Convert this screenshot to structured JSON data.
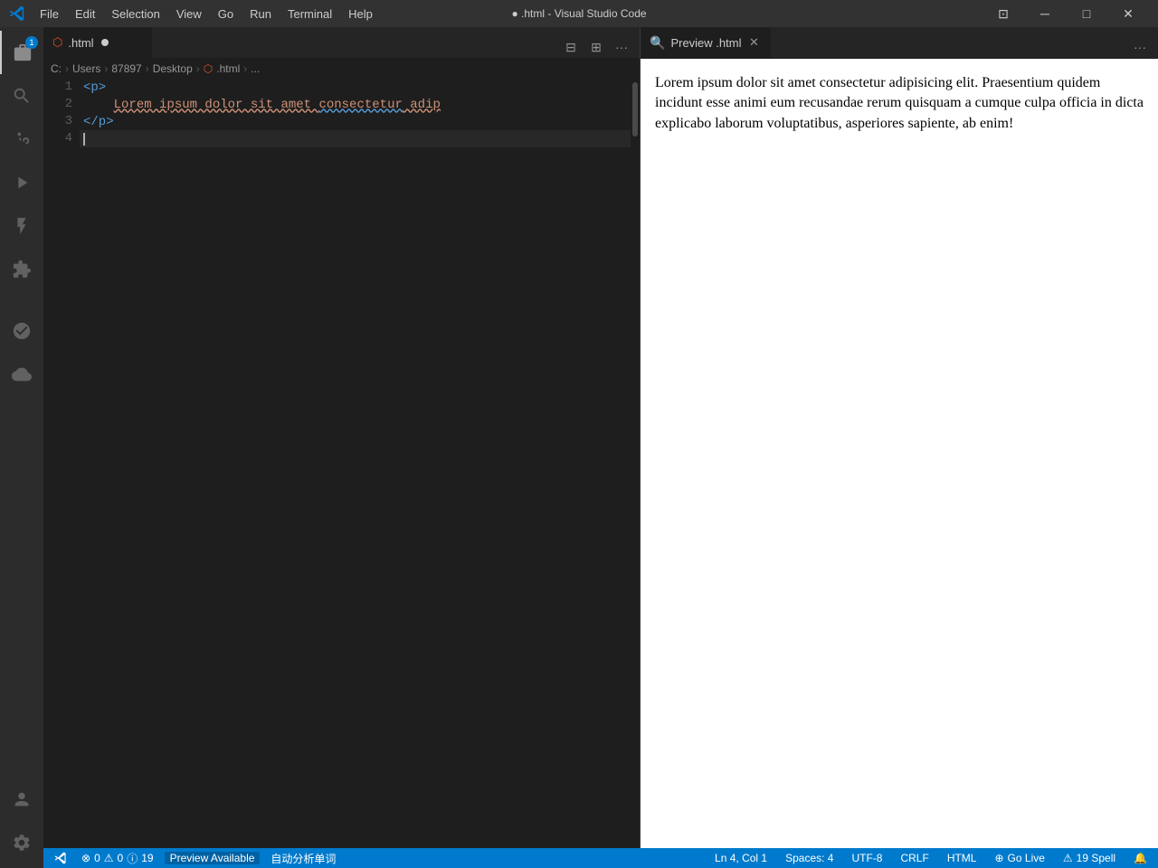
{
  "titlebar": {
    "title": "● .html - Visual Studio Code",
    "menu_items": [
      "File",
      "Edit",
      "Selection",
      "View",
      "Go",
      "Run",
      "Terminal",
      "Help"
    ],
    "controls": [
      "⊡",
      "─",
      "□",
      "×"
    ]
  },
  "activity_bar": {
    "icons": [
      {
        "name": "files",
        "symbol": "⎘",
        "badge": "1",
        "active": true
      },
      {
        "name": "search",
        "symbol": "🔍"
      },
      {
        "name": "source-control",
        "symbol": "⑂"
      },
      {
        "name": "run-debug",
        "symbol": "▷"
      },
      {
        "name": "testing",
        "symbol": "🧪"
      },
      {
        "name": "extensions",
        "symbol": "⊞"
      },
      {
        "name": "source-control-2",
        "symbol": "↺"
      },
      {
        "name": "cloud",
        "symbol": "☁"
      }
    ],
    "bottom_icons": [
      {
        "name": "account",
        "symbol": "👤"
      },
      {
        "name": "settings",
        "symbol": "⚙"
      }
    ]
  },
  "editor_tab": {
    "filename": ".html",
    "dirty": true,
    "icon_color": "#e44d26"
  },
  "breadcrumb": {
    "path": [
      "C:",
      "Users",
      "87897",
      "Desktop",
      ".html",
      "..."
    ]
  },
  "code": {
    "lines": [
      {
        "num": 1,
        "content": "<p>",
        "tokens": [
          {
            "text": "<p>",
            "type": "tag"
          }
        ]
      },
      {
        "num": 2,
        "content": "    Lorem ipsum dolor sit amet consectetur adip",
        "tokens": [
          {
            "text": "    Lorem ipsum dolor sit amet consectetur adip",
            "type": "text-wavy"
          }
        ]
      },
      {
        "num": 3,
        "content": "</p>",
        "tokens": [
          {
            "text": "</p>",
            "type": "tag"
          }
        ]
      },
      {
        "num": 4,
        "content": "",
        "tokens": []
      }
    ]
  },
  "preview_tab": {
    "title": "Preview .html",
    "icon": "🔍"
  },
  "preview_content": {
    "text": "Lorem ipsum dolor sit amet consectetur adipisicing elit. Praesentium quidem incidunt esse animi eum recusandae rerum quisquam a cumque culpa officia in dicta explicabo laborum voluptatibus, asperiores sapiente, ab enim!"
  },
  "status_bar": {
    "errors": "0",
    "warnings": "0",
    "info": "19",
    "preview_available": "Preview Available",
    "chinese_text": "自动分析单词",
    "position": "Ln 4, Col 1",
    "spaces": "Spaces: 4",
    "encoding": "UTF-8",
    "line_ending": "CRLF",
    "language": "HTML",
    "go_live": "Go Live",
    "spell": "19 Spell",
    "notifications": ""
  }
}
